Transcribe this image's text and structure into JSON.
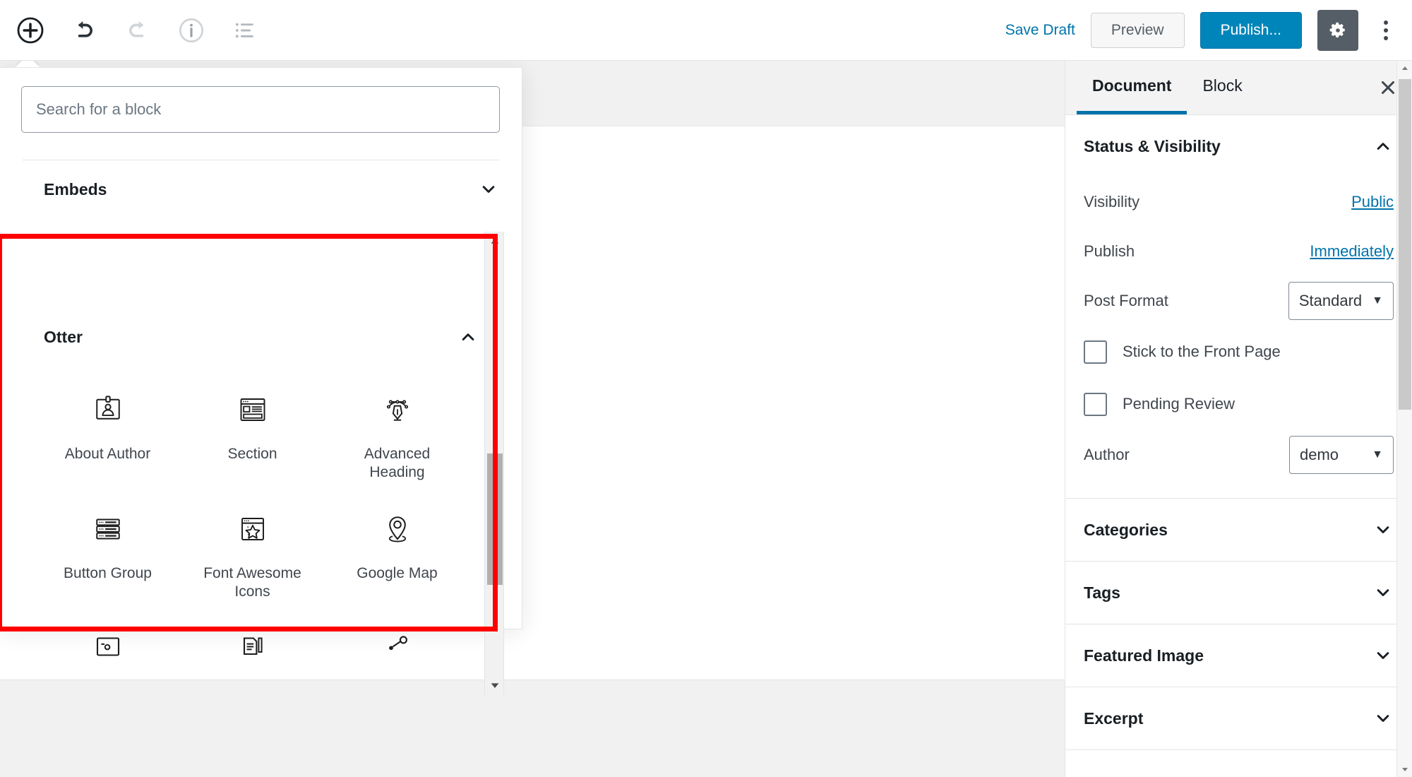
{
  "toolbar": {
    "left_icons": [
      {
        "name": "add-block-icon",
        "label": "Add block"
      },
      {
        "name": "undo-icon",
        "label": "Undo"
      },
      {
        "name": "redo-icon",
        "label": "Redo"
      },
      {
        "name": "content-info-icon",
        "label": "Content structure"
      },
      {
        "name": "block-navigation-icon",
        "label": "Block navigation"
      }
    ],
    "save_draft_label": "Save Draft",
    "preview_label": "Preview",
    "publish_label": "Publish...",
    "settings_icon": "gear-icon",
    "more_icon": "kebab-menu-icon",
    "accent_blue": "#0085ba",
    "link_blue": "#0073aa",
    "gear_bg": "#555d66"
  },
  "inserter": {
    "search": {
      "placeholder": "Search for a block",
      "value": ""
    },
    "categories": [
      {
        "title": "Embeds",
        "expanded": false,
        "chevron": "chevron-down-icon",
        "blocks": []
      },
      {
        "title": "Otter",
        "expanded": true,
        "chevron": "chevron-up-icon",
        "blocks": [
          {
            "label": "About Author",
            "icon": "id-badge-icon"
          },
          {
            "label": "Section",
            "icon": "layout-section-icon"
          },
          {
            "label": "Advanced Heading",
            "icon": "pen-tool-icon"
          },
          {
            "label": "Button Group",
            "icon": "stacked-bars-icon"
          },
          {
            "label": "Font Awesome Icons",
            "icon": "browser-star-icon"
          },
          {
            "label": "Google Map",
            "icon": "map-pin-icon"
          },
          {
            "label": "",
            "icon": "image-frame-icon"
          },
          {
            "label": "",
            "icon": "document-pencil-icon"
          },
          {
            "label": "",
            "icon": "sharing-node-icon"
          }
        ]
      }
    ],
    "scrollbar": {
      "up_icon": "scroll-up-arrow-icon",
      "down_icon": "scroll-down-arrow-icon"
    }
  },
  "highlight": {
    "color": "#ff0000"
  },
  "sidebar": {
    "tabs": [
      {
        "label": "Document",
        "active": true
      },
      {
        "label": "Block",
        "active": false
      }
    ],
    "close_icon": "close-icon",
    "status_visibility": {
      "title": "Status & Visibility",
      "expanded": true,
      "chevron": "chevron-up-icon",
      "visibility_label": "Visibility",
      "visibility_value": "Public",
      "publish_label": "Publish",
      "publish_value": "Immediately",
      "post_format_label": "Post Format",
      "post_format_value": "Standard",
      "post_format_caret": "caret-down-icon",
      "sticky_label": "Stick to the Front Page",
      "sticky_checked": false,
      "pending_label": "Pending Review",
      "pending_checked": false,
      "author_label": "Author",
      "author_value": "demo",
      "author_caret": "caret-down-icon"
    },
    "panels": [
      {
        "title": "Categories",
        "expanded": false,
        "chevron": "chevron-down-icon"
      },
      {
        "title": "Tags",
        "expanded": false,
        "chevron": "chevron-down-icon"
      },
      {
        "title": "Featured Image",
        "expanded": false,
        "chevron": "chevron-down-icon"
      },
      {
        "title": "Excerpt",
        "expanded": false,
        "chevron": "chevron-down-icon"
      }
    ]
  }
}
